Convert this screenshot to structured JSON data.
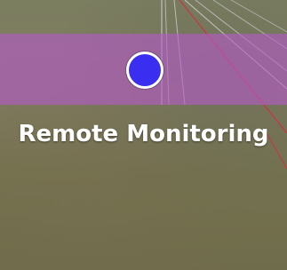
{
  "overlay": {
    "title": "Remote Monitoring",
    "band_color": "#b45ac8",
    "marker_color": "#3a2ef0",
    "marker_icon": "location-dot-icon"
  }
}
